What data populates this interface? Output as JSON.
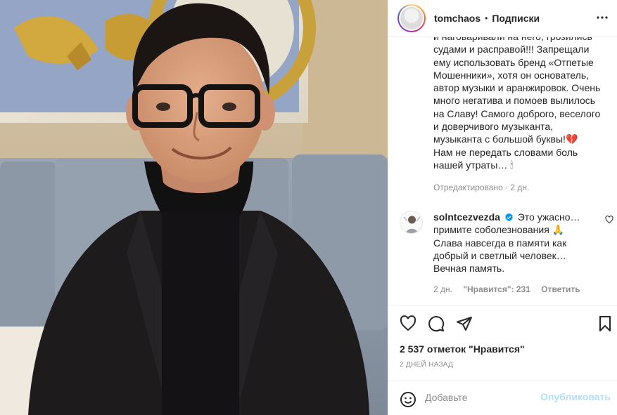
{
  "post": {
    "photo_alt": "",
    "author": "tomchaos",
    "separator": "•",
    "follow_label": "Подписки",
    "more_icon": "more-horizontal-icon",
    "caption_lines": [
      "и наговаривали на него, грозились",
      "судами и расправой!!! Запрещали",
      "ему использовать бренд «Отпетые",
      "Мошенники», хотя он основатель,",
      "автор музыки и аранжировок. Очень",
      "много негатива и помоев вылилось",
      "на Славу! Самого доброго, веселого",
      "и доверчивого музыканта,",
      "музыканта с большой буквы!💔",
      "Нам не передать словами боль",
      "нашей утраты… 🕯"
    ],
    "edited_label": "Отредактировано · 2 дн."
  },
  "comment": {
    "username": "solntcezvezda",
    "verified": true,
    "lines": [
      "Это ужасно…",
      "примите соболезнования 🙏",
      "Слава навсегда в памяти как",
      "добрый и светлый человек…",
      "Вечная память."
    ],
    "time": "2 дн.",
    "likes": "\"Нравится\": 231",
    "reply_label": "Ответить"
  },
  "actions": {
    "likes_count": "2 537 отметок \"Нравится\"",
    "date": "2 ДНЕЙ НАЗАД"
  },
  "add_comment": {
    "placeholder": "Добавьте",
    "publish_label": "Опубликовать"
  },
  "colors": {
    "link_disabled": "#b2dffc",
    "secondary_text": "#8e8e8e",
    "verified": "#0095f6",
    "border": "#efefef"
  }
}
